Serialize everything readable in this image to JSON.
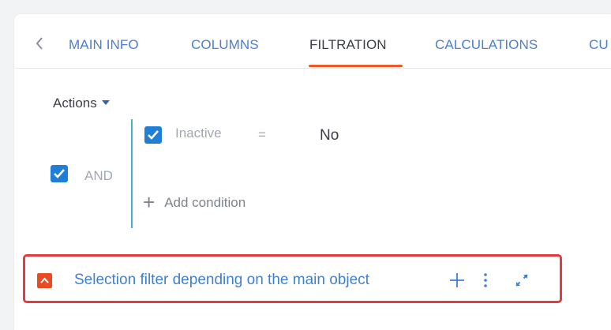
{
  "tabs": {
    "items": [
      {
        "label": "MAIN INFO"
      },
      {
        "label": "COLUMNS"
      },
      {
        "label": "FILTRATION"
      },
      {
        "label": "CALCULATIONS"
      },
      {
        "label": "CU"
      }
    ],
    "active_index": 2
  },
  "filter": {
    "actions_label": "Actions",
    "group": {
      "operator": "AND",
      "checked": true
    },
    "conditions": [
      {
        "field": "Inactive",
        "operator": "=",
        "value": "No",
        "checked": true
      }
    ],
    "add_condition_label": "Add condition"
  },
  "selection_filter": {
    "label": "Selection filter depending on the main object",
    "collapsed": false
  },
  "colors": {
    "accent": "#ea5a2a",
    "link": "#3f7fd4",
    "checkbox": "#1f7ed6",
    "group_line": "#47b0d8",
    "highlight": "#e23b3f"
  },
  "icons": [
    "chevron-left-icon",
    "caret-down-icon",
    "checkmark-icon",
    "plus-icon",
    "collapse-icon",
    "more-vertical-icon",
    "expand-icon"
  ]
}
